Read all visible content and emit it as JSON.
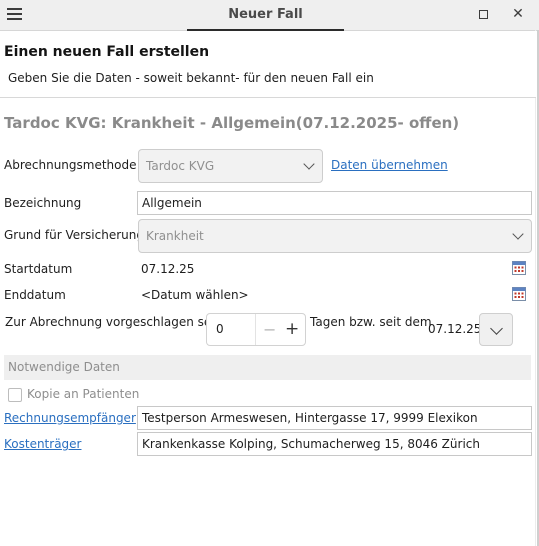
{
  "window": {
    "title": "Neuer Fall",
    "menu_icon": "hamburger-icon",
    "maximize_icon": "maximize-icon",
    "close_icon": "close-icon",
    "close_glyph": "✕"
  },
  "header": {
    "title": "Einen neuen Fall erstellen",
    "subtitle": "Geben Sie die Daten - soweit bekannt- für den neuen Fall ein"
  },
  "case_title": "Tardoc KVG: Krankheit - Allgemein(07.12.2025- offen)",
  "form": {
    "billing_method": {
      "label": "Abrechnungsmethode",
      "value": "Tardoc KVG",
      "link": "Daten übernehmen"
    },
    "designation": {
      "label": "Bezeichnung",
      "value": "Allgemein"
    },
    "insurance_reason": {
      "label": "Grund für Versicherung",
      "value": "Krankheit"
    },
    "start_date": {
      "label": "Startdatum",
      "value": "07.12.25",
      "icon": "calendar-icon"
    },
    "end_date": {
      "label": "Enddatum",
      "value": "<Datum wählen>",
      "icon": "calendar-icon"
    },
    "billing_suggestion": {
      "label": "Zur Abrechnung vorgeschlagen seit",
      "value": "0",
      "minus": "−",
      "plus": "+",
      "days_label": "Tagen bzw. seit dem",
      "date": "07.12.25"
    }
  },
  "required": {
    "section_title": "Notwendige Daten",
    "copy_to_patient": {
      "label": "Kopie an Patienten",
      "checked": false
    },
    "invoice_recipient": {
      "label": "Rechnungsempfänger",
      "value": "Testperson Armeswesen, Hintergasse 17, 9999 Elexikon"
    },
    "cost_bearer": {
      "label": "Kostenträger",
      "value": "Krankenkasse Kolping, Schumacherweg 15, 8046 Zürich"
    }
  },
  "colors": {
    "link": "#2a6fc0",
    "disabled_text": "#909090",
    "title_grey": "#8a8a8a"
  }
}
